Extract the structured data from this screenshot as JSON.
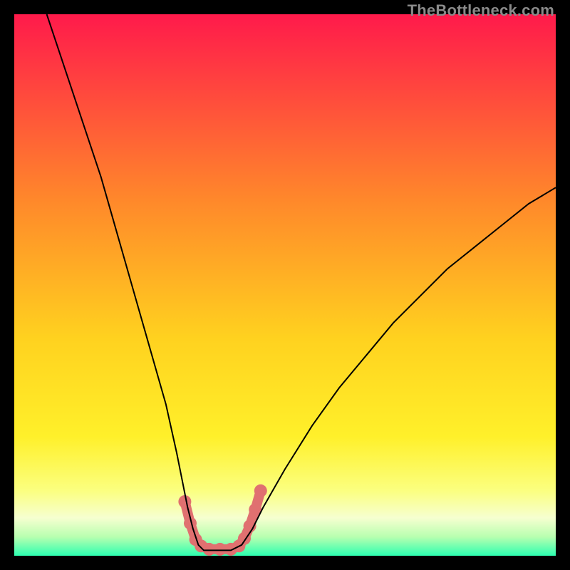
{
  "watermark": "TheBottleneck.com",
  "chart_data": {
    "type": "line",
    "title": "",
    "xlabel": "",
    "ylabel": "",
    "xlim": [
      0,
      100
    ],
    "ylim": [
      0,
      100
    ],
    "grid": false,
    "legend": false,
    "background_gradient": {
      "direction": "vertical",
      "stops": [
        {
          "pos": 0.0,
          "color": "#ff1a4b"
        },
        {
          "pos": 0.35,
          "color": "#ff8a2a"
        },
        {
          "pos": 0.6,
          "color": "#ffd21f"
        },
        {
          "pos": 0.78,
          "color": "#fff02a"
        },
        {
          "pos": 0.88,
          "color": "#fbff80"
        },
        {
          "pos": 0.93,
          "color": "#f6ffd0"
        },
        {
          "pos": 0.965,
          "color": "#b8ffb0"
        },
        {
          "pos": 1.0,
          "color": "#2dffb0"
        }
      ]
    },
    "series": [
      {
        "name": "bottleneck-curve",
        "stroke": "#000000",
        "stroke_width": 2,
        "x": [
          6,
          8,
          10,
          12,
          14,
          16,
          18,
          20,
          22,
          24,
          26,
          28,
          30,
          31,
          32,
          33,
          34,
          35,
          36,
          38,
          40,
          42,
          44,
          46,
          50,
          55,
          60,
          65,
          70,
          75,
          80,
          85,
          90,
          95,
          100
        ],
        "y": [
          100,
          94,
          88,
          82,
          76,
          70,
          63,
          56,
          49,
          42,
          35,
          28,
          19,
          14,
          9,
          5,
          2,
          1,
          1,
          1,
          1,
          2,
          5,
          9,
          16,
          24,
          31,
          37,
          43,
          48,
          53,
          57,
          61,
          65,
          68
        ]
      },
      {
        "name": "optimal-band-marker",
        "type": "scatter",
        "stroke": "#e07070",
        "stroke_width": 14,
        "marker_radius": 9,
        "x": [
          31.5,
          32.5,
          33.5,
          34.5,
          36.0,
          38.0,
          40.0,
          41.5,
          42.5,
          43.5,
          44.5,
          45.5
        ],
        "y": [
          10.0,
          6.0,
          3.0,
          1.8,
          1.2,
          1.2,
          1.2,
          1.8,
          3.2,
          5.5,
          8.5,
          12.0
        ]
      }
    ],
    "minimum_at_x": 38,
    "minimum_value": 1
  }
}
